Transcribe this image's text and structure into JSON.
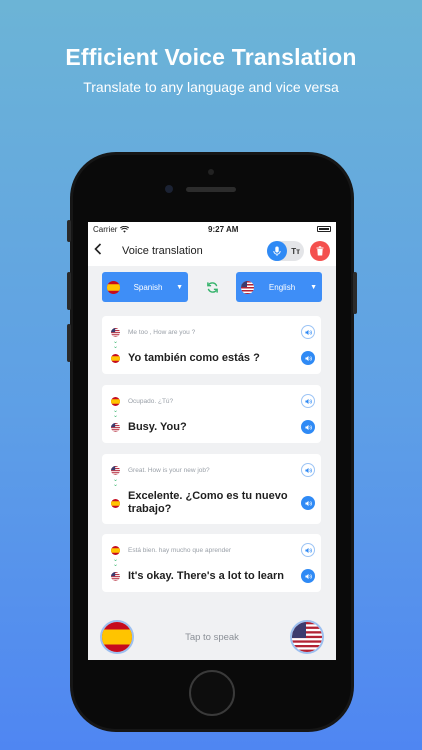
{
  "promo": {
    "headline": "Efficient Voice Translation",
    "subhead": "Translate to any language and vice versa"
  },
  "status_bar": {
    "carrier": "Carrier",
    "time": "9:27 AM"
  },
  "navbar": {
    "title": "Voice translation",
    "text_size_label": "Tт"
  },
  "languages": {
    "source": {
      "label": "Spanish",
      "flag": "spain-flag-icon"
    },
    "target": {
      "label": "English",
      "flag": "usa-flag-icon"
    }
  },
  "conversations": [
    {
      "original": "Me too , How are you ?",
      "original_flag": "usa-flag-icon",
      "translation": "Yo también como estás ?",
      "translation_flag": "spain-flag-icon"
    },
    {
      "original": "Ocupado. ¿Tú?",
      "original_flag": "spain-flag-icon",
      "translation": "Busy. You?",
      "translation_flag": "usa-flag-icon"
    },
    {
      "original": "Great. How is your new job?",
      "original_flag": "usa-flag-icon",
      "translation": "Excelente. ¿Como es tu nuevo trabajo?",
      "translation_flag": "spain-flag-icon"
    },
    {
      "original": "Está bien. hay mucho que aprender",
      "original_flag": "spain-flag-icon",
      "translation": "It's okay. There's a lot to learn",
      "translation_flag": "usa-flag-icon"
    }
  ],
  "bottom_bar": {
    "hint": "Tap to speak"
  },
  "colors": {
    "accent": "#3e8ef7",
    "delete": "#f4504e",
    "swap": "#35b36b"
  }
}
